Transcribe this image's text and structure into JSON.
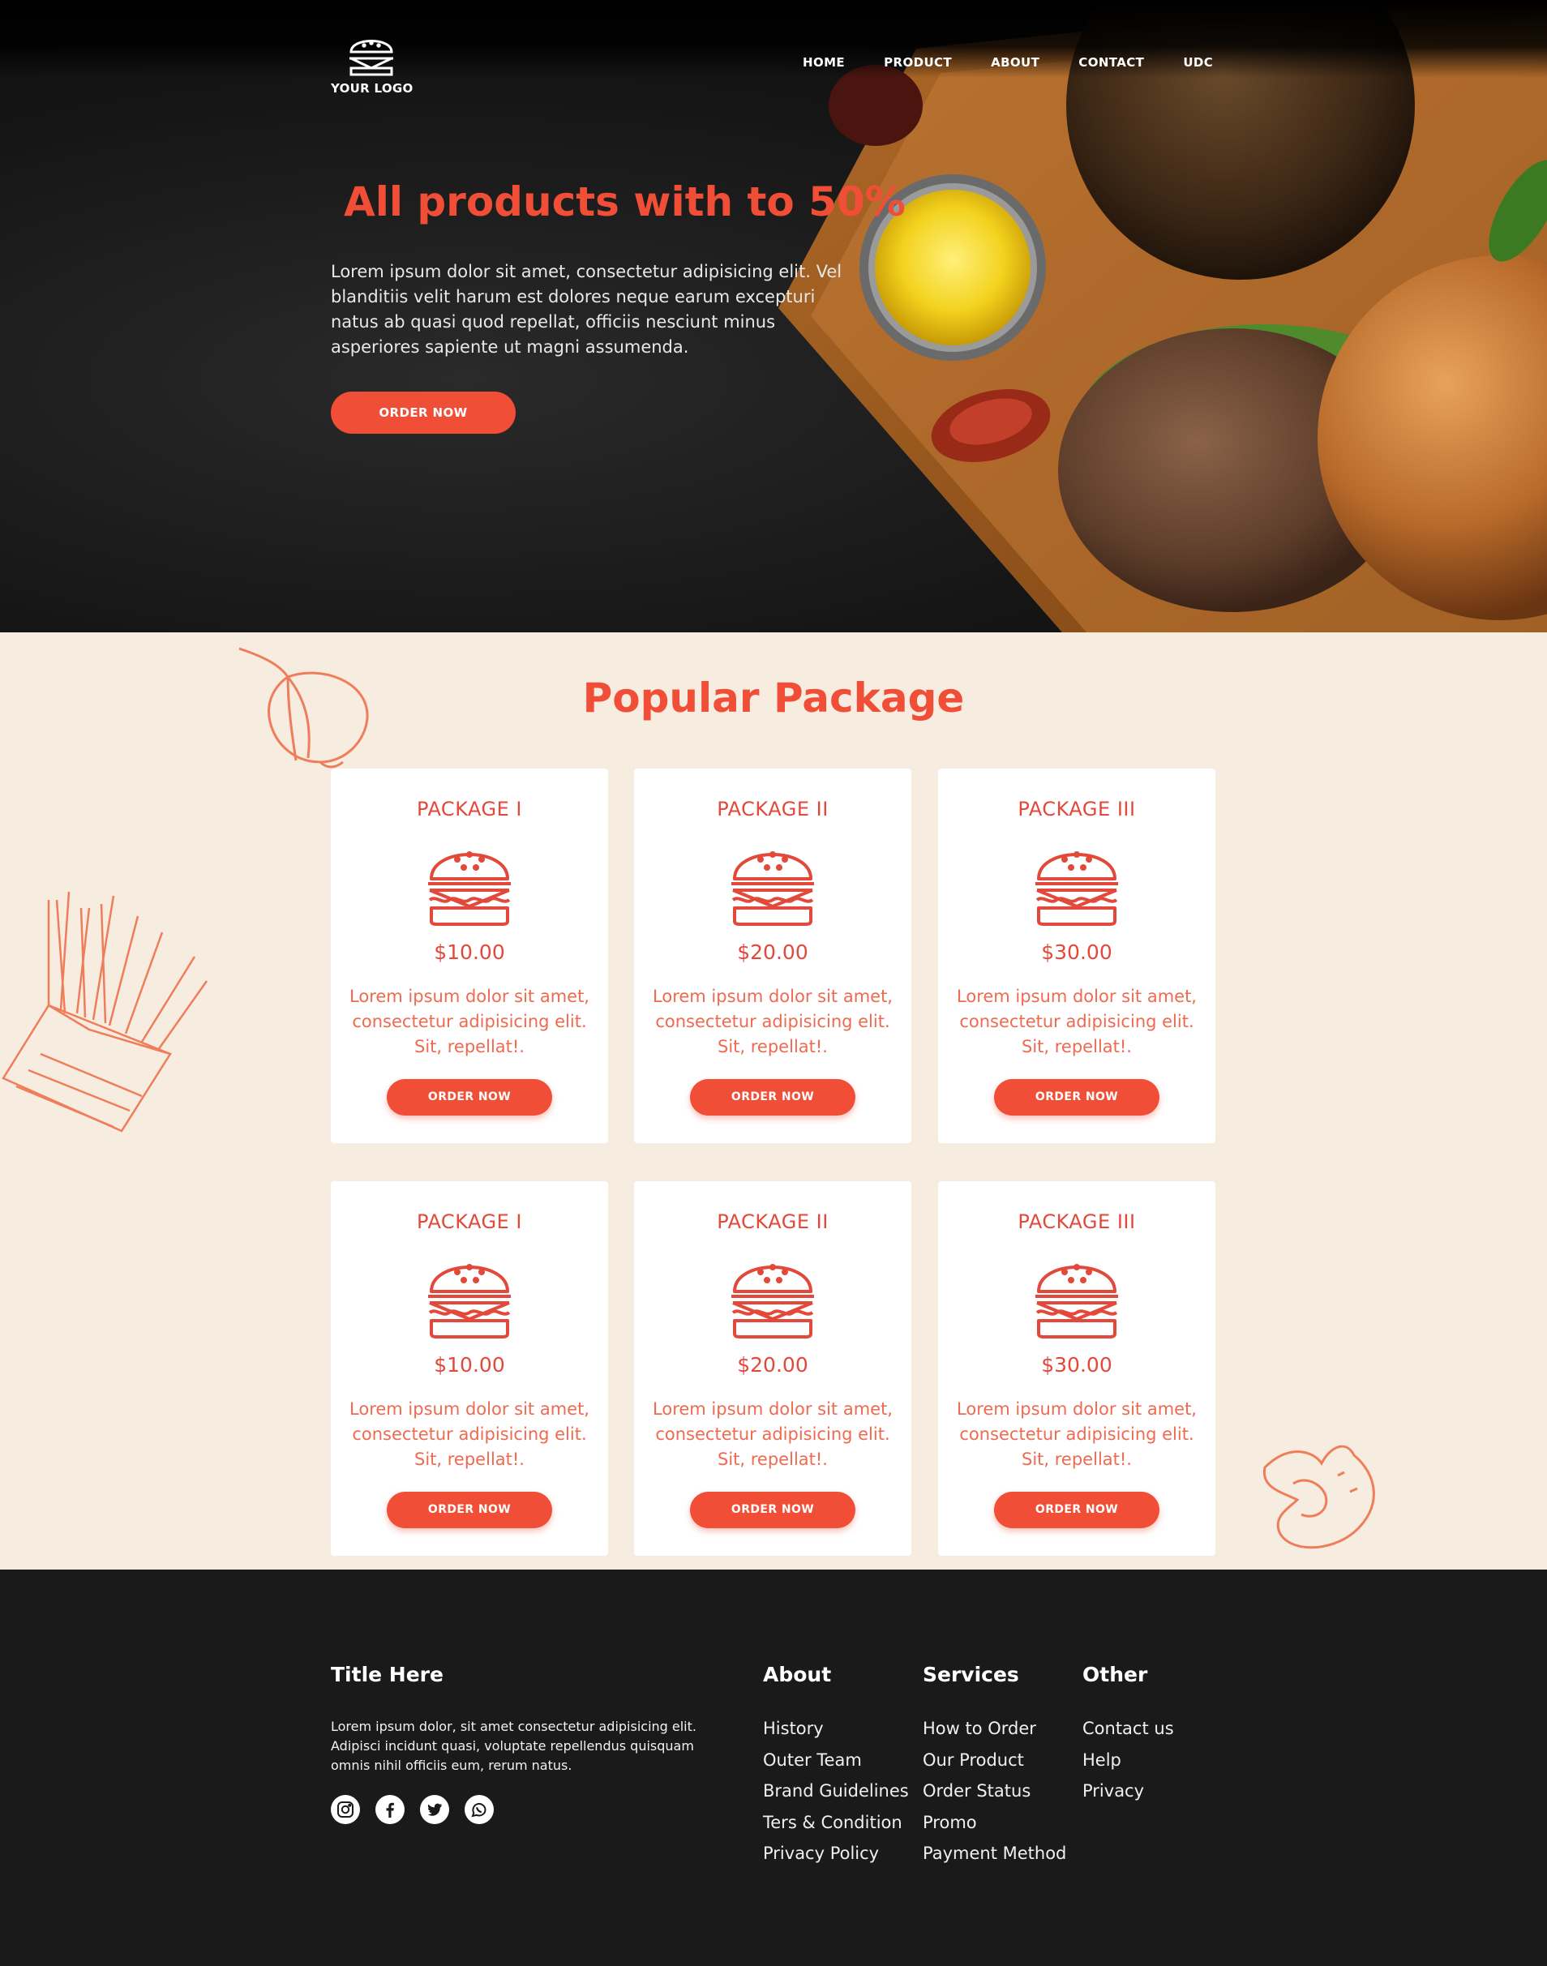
{
  "header": {
    "logo_text": "YOUR LOGO",
    "nav": [
      "HOME",
      "PRODUCT",
      "ABOUT",
      "CONTACT",
      "UDC"
    ]
  },
  "hero": {
    "title": "All products with to 50%",
    "text": "Lorem ipsum dolor sit amet, consectetur adipisicing elit. Vel blanditiis velit harum est dolores neque earum excepturi natus ab quasi quod repellat, officiis nesciunt minus asperiores sapiente ut magni assumenda.",
    "button": "ORDER NOW"
  },
  "packages": {
    "title": "Popular Package",
    "cards": [
      {
        "title": "PACKAGE I",
        "price": "$10.00",
        "desc": "Lorem ipsum dolor sit amet, consectetur adipisicing elit. Sit, repellat!.",
        "button": "ORDER NOW"
      },
      {
        "title": "PACKAGE II",
        "price": "$20.00",
        "desc": "Lorem ipsum dolor sit amet, consectetur adipisicing elit. Sit, repellat!.",
        "button": "ORDER NOW"
      },
      {
        "title": "PACKAGE III",
        "price": "$30.00",
        "desc": "Lorem ipsum dolor sit amet, consectetur adipisicing elit. Sit, repellat!.",
        "button": "ORDER NOW"
      },
      {
        "title": "PACKAGE I",
        "price": "$10.00",
        "desc": "Lorem ipsum dolor sit amet, consectetur adipisicing elit. Sit, repellat!.",
        "button": "ORDER NOW"
      },
      {
        "title": "PACKAGE II",
        "price": "$20.00",
        "desc": "Lorem ipsum dolor sit amet, consectetur adipisicing elit. Sit, repellat!.",
        "button": "ORDER NOW"
      },
      {
        "title": "PACKAGE III",
        "price": "$30.00",
        "desc": "Lorem ipsum dolor sit amet, consectetur adipisicing elit. Sit, repellat!.",
        "button": "ORDER NOW"
      }
    ]
  },
  "footer": {
    "title": "Title Here",
    "text": "Lorem ipsum dolor, sit amet consectetur adipisicing elit. Adipisci incidunt quasi, voluptate repellendus quisquam omnis nihil officiis eum, rerum natus.",
    "social_icons": [
      "instagram-icon",
      "facebook-icon",
      "twitter-icon",
      "whatsapp-icon"
    ],
    "about": {
      "title": "About",
      "items": [
        "History",
        "Outer Team",
        "Brand Guidelines",
        "Ters & Condition",
        "Privacy Policy"
      ]
    },
    "services": {
      "title": "Services",
      "items": [
        "How to Order",
        "Our Product",
        "Order Status",
        "Promo",
        "Payment Method"
      ]
    },
    "other": {
      "title": "Other",
      "items": [
        "Contact us",
        "Help",
        "Privacy"
      ]
    }
  },
  "colors": {
    "accent": "#f04e37",
    "cream": "#f6ece0",
    "footer_bg": "#1b1a1b"
  }
}
